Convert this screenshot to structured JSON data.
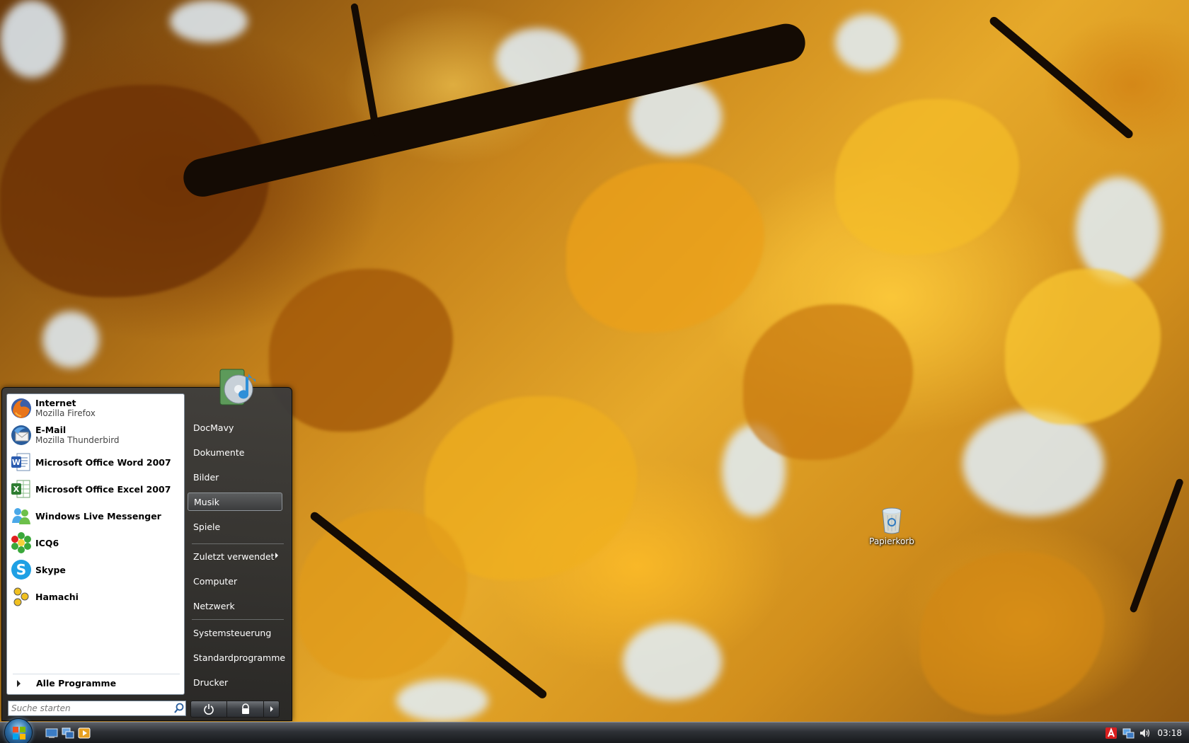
{
  "desktop": {
    "recycle_bin_label": "Papierkorb"
  },
  "start_menu": {
    "pinned": [
      {
        "title": "Internet",
        "subtitle": "Mozilla Firefox",
        "icon": "firefox-icon"
      },
      {
        "title": "E-Mail",
        "subtitle": "Mozilla Thunderbird",
        "icon": "thunderbird-icon"
      }
    ],
    "recent": [
      {
        "title": "Microsoft Office Word 2007",
        "icon": "word-icon"
      },
      {
        "title": "Microsoft Office Excel 2007",
        "icon": "excel-icon"
      },
      {
        "title": "Windows Live Messenger",
        "icon": "messenger-icon"
      },
      {
        "title": "ICQ6",
        "icon": "icq-icon"
      },
      {
        "title": "Skype",
        "icon": "skype-icon"
      },
      {
        "title": "Hamachi",
        "icon": "hamachi-icon"
      }
    ],
    "all_programs_label": "Alle Programme",
    "search_placeholder": "Suche starten",
    "places": [
      {
        "label": "DocMavy"
      },
      {
        "label": "Dokumente"
      },
      {
        "label": "Bilder"
      },
      {
        "label": "Musik",
        "highlighted": true
      },
      {
        "label": "Spiele"
      },
      {
        "label": "Zuletzt verwendet",
        "has_submenu": true
      },
      {
        "label": "Computer"
      },
      {
        "label": "Netzwerk"
      },
      {
        "label": "Systemsteuerung"
      },
      {
        "label": "Standardprogramme"
      },
      {
        "label": "Drucker"
      }
    ]
  },
  "taskbar": {
    "clock": "03:18",
    "quick_launch": [
      "show-desktop-icon",
      "switch-windows-icon",
      "media-player-icon"
    ],
    "tray_icons": [
      "antivirus-icon",
      "network-icon",
      "volume-icon"
    ]
  },
  "colors": {
    "menu_bg": "#2b2d31",
    "taskbar": "#24272b",
    "highlight_border": "#8e9499"
  }
}
